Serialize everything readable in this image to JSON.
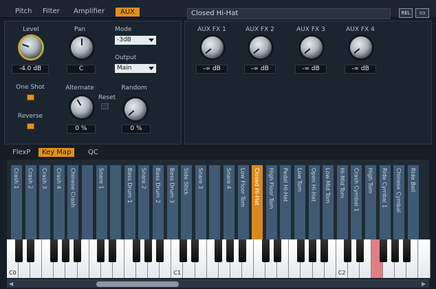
{
  "header": {
    "tabs": [
      "Pitch",
      "Filter",
      "Amplifier",
      "AUX"
    ],
    "preset": "Closed Hi-Hat",
    "btn_rel": "REL",
    "btn_icon": "book-icon"
  },
  "left": {
    "level": {
      "label": "Level",
      "value": "-4.0 dB"
    },
    "pan": {
      "label": "Pan",
      "value": "C"
    },
    "mode": {
      "label": "Mode",
      "value": "-3dB"
    },
    "output": {
      "label": "Output",
      "value": "Main"
    },
    "one_shot": "One Shot",
    "reverse": "Reverse",
    "alternate": {
      "label": "Alternate",
      "value": "0 %"
    },
    "reset": "Reset",
    "random": {
      "label": "Random",
      "value": "0 %"
    }
  },
  "aux": {
    "fx": [
      {
        "label": "AUX FX 1",
        "value": "-∞ dB"
      },
      {
        "label": "AUX FX 2",
        "value": "-∞ dB"
      },
      {
        "label": "AUX FX 3",
        "value": "-∞ dB"
      },
      {
        "label": "AUX FX 4",
        "value": "-∞ dB"
      }
    ]
  },
  "subtabs": [
    "FlexP",
    "Key Map",
    "QC"
  ],
  "keymap": [
    "Crash 1",
    "Crash 2",
    "Crash 3",
    "Crash 4",
    "Chinese Crash",
    "",
    "Snare 1",
    "",
    "Bass Drum 1",
    "Snare 2",
    "Bass Drum 2",
    "Bass Drum 3",
    "Side Stick",
    "Snare 3",
    "",
    "Snare 4",
    "Low Floor Tom",
    "Closed Hi-Hat",
    "High Floor Tom",
    "Pedal Hi-Hat",
    "Low Tom",
    "Open Hi-Hat",
    "Low-Mid Tom",
    "Hi-Mid Tom",
    "Crash Cymbal 1",
    "High Tom",
    "Ride Cymbal 1",
    "Chinese Cymbal",
    "Ride Bell"
  ],
  "active_keymap": "Closed Hi-Hat",
  "keyboard": {
    "labels": [
      "C0",
      "C1",
      "C2"
    ]
  }
}
